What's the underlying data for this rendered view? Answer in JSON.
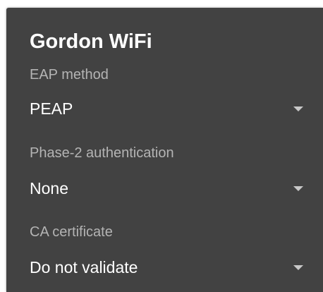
{
  "dialog": {
    "title": "Gordon WiFi",
    "fields": [
      {
        "label": "EAP method",
        "value": "PEAP",
        "icon": "dropdown-arrow-icon"
      },
      {
        "label": "Phase-2 authentication",
        "value": "None",
        "icon": "dropdown-arrow-icon"
      },
      {
        "label": "CA certificate",
        "value": "Do not validate",
        "icon": "dropdown-arrow-icon"
      }
    ]
  },
  "colors": {
    "dialog_background": "#424242",
    "title_text": "#ffffff",
    "label_text": "#b4b4b4",
    "value_text": "#ffffff"
  }
}
